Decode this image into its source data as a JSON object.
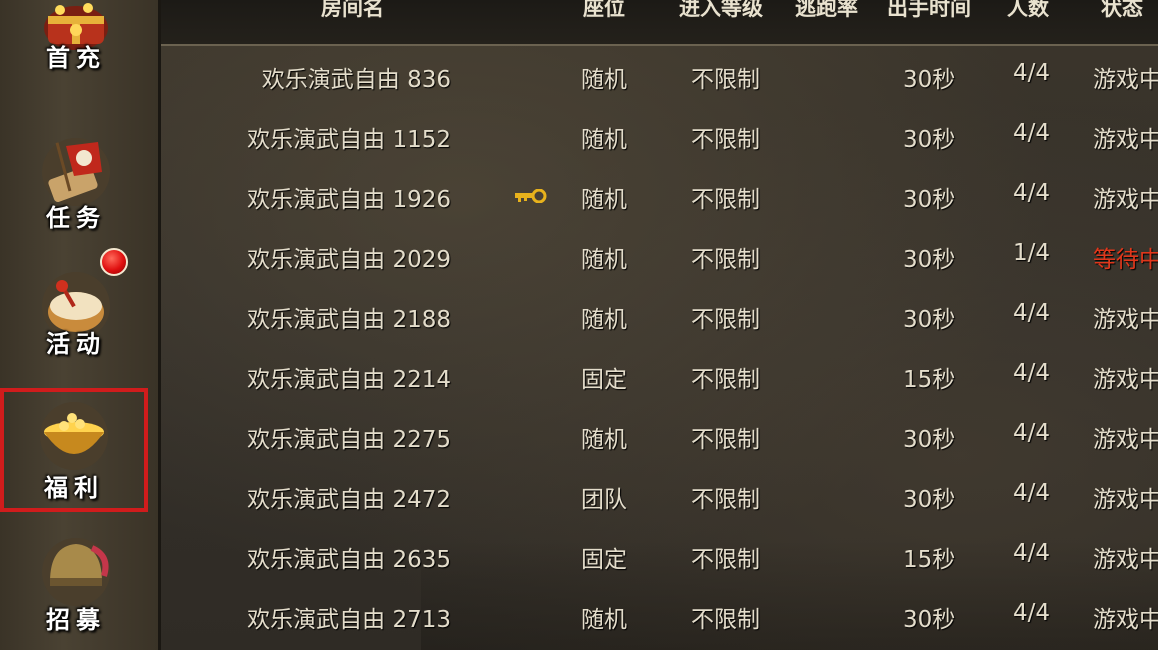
{
  "sidebar": {
    "items": [
      {
        "label": "首充",
        "icon": "treasure-chest-icon"
      },
      {
        "label": "任务",
        "icon": "quest-scroll-icon"
      },
      {
        "label": "活动",
        "icon": "activity-drum-icon",
        "notification": true
      },
      {
        "label": "福利",
        "icon": "gold-bowl-icon",
        "selected": true
      },
      {
        "label": "招募",
        "icon": "helmet-icon"
      }
    ]
  },
  "table": {
    "headers": {
      "name": "房间名",
      "seat": "座位",
      "level": "进入等级",
      "escape": "逃跑率",
      "time": "出手时间",
      "count": "人数",
      "status": "状态"
    },
    "rows": [
      {
        "name": "欢乐演武自由 836",
        "seat": "随机",
        "level": "不限制",
        "time": "30秒",
        "count": "4/4",
        "status": "游戏中",
        "locked": false
      },
      {
        "name": "欢乐演武自由 1152",
        "seat": "随机",
        "level": "不限制",
        "time": "30秒",
        "count": "4/4",
        "status": "游戏中",
        "locked": false
      },
      {
        "name": "欢乐演武自由 1926",
        "seat": "随机",
        "level": "不限制",
        "time": "30秒",
        "count": "4/4",
        "status": "游戏中",
        "locked": true
      },
      {
        "name": "欢乐演武自由 2029",
        "seat": "随机",
        "level": "不限制",
        "time": "30秒",
        "count": "1/4",
        "status": "等待中",
        "locked": false
      },
      {
        "name": "欢乐演武自由 2188",
        "seat": "随机",
        "level": "不限制",
        "time": "30秒",
        "count": "4/4",
        "status": "游戏中",
        "locked": false
      },
      {
        "name": "欢乐演武自由 2214",
        "seat": "固定",
        "level": "不限制",
        "time": "15秒",
        "count": "4/4",
        "status": "游戏中",
        "locked": false
      },
      {
        "name": "欢乐演武自由 2275",
        "seat": "随机",
        "level": "不限制",
        "time": "30秒",
        "count": "4/4",
        "status": "游戏中",
        "locked": false
      },
      {
        "name": "欢乐演武自由 2472",
        "seat": "团队",
        "level": "不限制",
        "time": "30秒",
        "count": "4/4",
        "status": "游戏中",
        "locked": false
      },
      {
        "name": "欢乐演武自由 2635",
        "seat": "固定",
        "level": "不限制",
        "time": "15秒",
        "count": "4/4",
        "status": "游戏中",
        "locked": false
      },
      {
        "name": "欢乐演武自由 2713",
        "seat": "随机",
        "level": "不限制",
        "time": "30秒",
        "count": "4/4",
        "status": "游戏中",
        "locked": false
      }
    ]
  },
  "colors": {
    "waiting_status": "#e0371b",
    "selection_border": "#d01c1c",
    "key": "#e8b21c"
  }
}
